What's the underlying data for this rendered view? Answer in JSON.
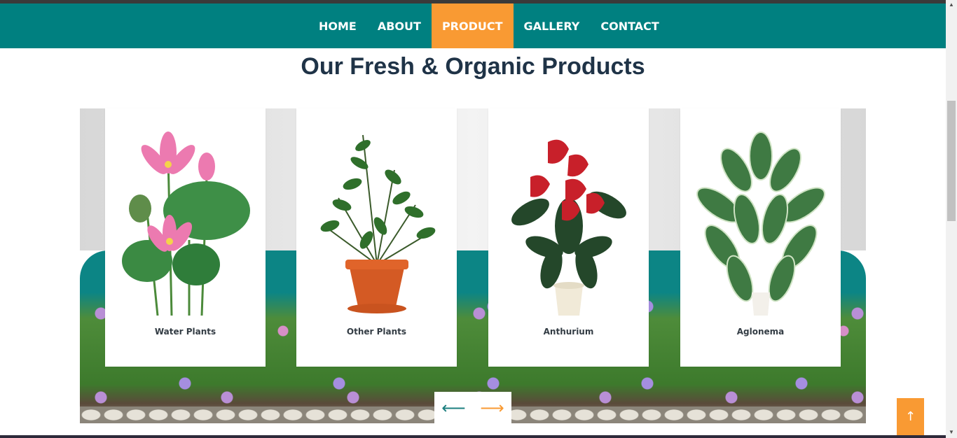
{
  "nav": {
    "items": [
      {
        "label": "HOME",
        "active": false
      },
      {
        "label": "ABOUT",
        "active": false
      },
      {
        "label": "PRODUCT",
        "active": true
      },
      {
        "label": "GALLERY",
        "active": false
      },
      {
        "label": "CONTACT",
        "active": false
      }
    ],
    "bar_color": "#008080",
    "active_color": "#f99a33"
  },
  "section": {
    "heading": "Our Fresh & Organic Products"
  },
  "products": [
    {
      "name": "Water Plants",
      "icon": "lotus-plant-image"
    },
    {
      "name": "Other Plants",
      "icon": "potted-zz-plant-image"
    },
    {
      "name": "Anthurium",
      "icon": "anthurium-plant-image"
    },
    {
      "name": "Aglonema",
      "icon": "aglonema-plant-image"
    }
  ],
  "slider_controls": {
    "prev_icon": "arrow-left-icon",
    "next_icon": "arrow-right-icon",
    "prev_glyph": "⟵",
    "next_glyph": "⟶"
  },
  "back_to_top": {
    "icon": "arrow-up-icon",
    "glyph": "↑"
  }
}
